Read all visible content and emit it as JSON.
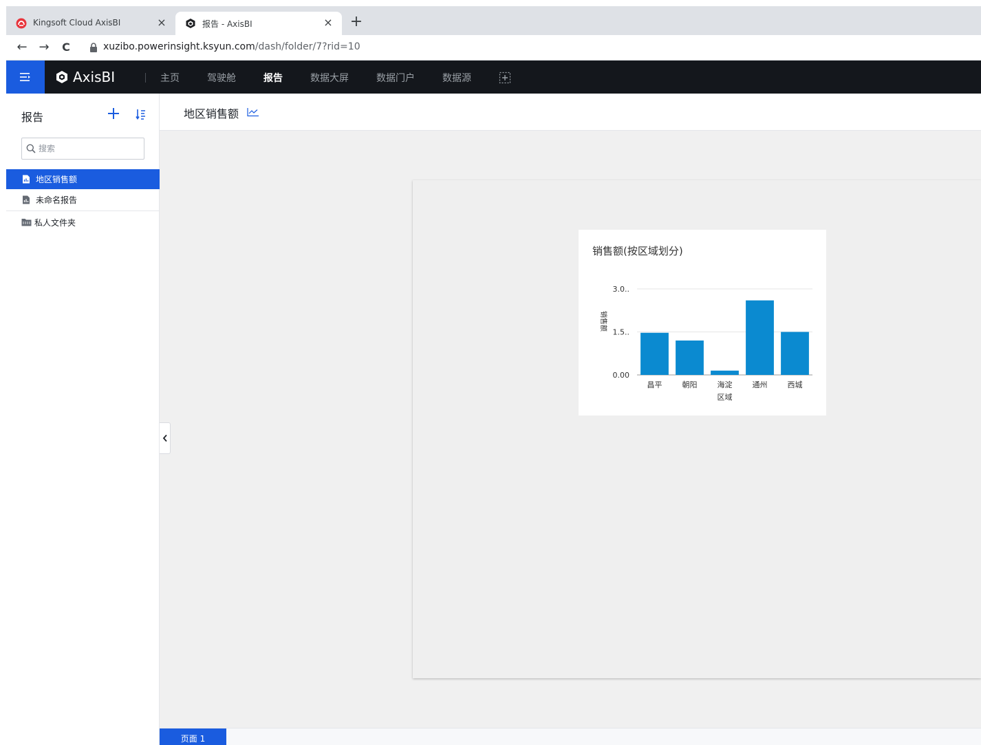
{
  "browser": {
    "tabs": [
      {
        "title": "Kingsoft Cloud AxisBI",
        "active": false,
        "favicon": "kingsoft-cloud-icon"
      },
      {
        "title": "报告 - AxisBI",
        "active": true,
        "favicon": "axisbi-icon"
      }
    ],
    "close_glyph": "×",
    "newtab_glyph": "+",
    "back_glyph": "←",
    "forward_glyph": "→",
    "reload_glyph": "C",
    "url_host": "xuzibo.powerinsight.ksyun.com",
    "url_path": "/dash/folder/7?rid=10"
  },
  "navbar": {
    "brand": "AxisBI",
    "items": [
      {
        "label": "主页",
        "active": false
      },
      {
        "label": "驾驶舱",
        "active": false
      },
      {
        "label": "报告",
        "active": true
      },
      {
        "label": "数据大屏",
        "active": false
      },
      {
        "label": "数据门户",
        "active": false
      },
      {
        "label": "数据源",
        "active": false
      }
    ]
  },
  "sidebar": {
    "title": "报告",
    "search_placeholder": "搜索",
    "reports": [
      {
        "label": "地区销售额",
        "active": true
      },
      {
        "label": "未命名报告",
        "active": false
      }
    ],
    "folder": "私人文件夹"
  },
  "main": {
    "report_title": "地区销售额",
    "page_tab": "页面 1"
  },
  "colors": {
    "accent": "#1a5cdf",
    "navbar_bg": "#14171c",
    "bar": "#0b8ad0"
  },
  "chart_data": {
    "type": "bar",
    "title": "销售额(按区域划分)",
    "xlabel": "区域",
    "ylabel": "销售额",
    "categories": [
      "昌平",
      "朝阳",
      "海淀",
      "通州",
      "西城"
    ],
    "values": [
      1.47,
      1.2,
      0.15,
      2.6,
      1.5
    ],
    "y_ticks": [
      "0.00",
      "1.5..",
      "3.0.."
    ],
    "ylim": [
      0,
      3.0
    ],
    "grid": true,
    "legend": "none"
  }
}
